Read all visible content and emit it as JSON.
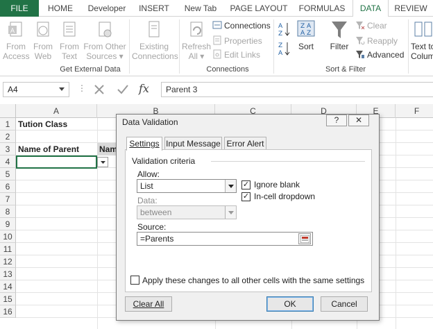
{
  "ribbon_tabs": [
    "FILE",
    "HOME",
    "Developer",
    "INSERT",
    "New Tab",
    "PAGE LAYOUT",
    "FORMULAS",
    "DATA",
    "REVIEW"
  ],
  "ribbon": {
    "get_external": {
      "from_access": [
        "From",
        "Access"
      ],
      "from_web": [
        "From",
        "Web"
      ],
      "from_text": [
        "From",
        "Text"
      ],
      "from_other": [
        "From Other",
        "Sources ▾"
      ],
      "existing": [
        "Existing",
        "Connections"
      ],
      "label": "Get External Data"
    },
    "connections": {
      "refresh": [
        "Refresh",
        "All ▾"
      ],
      "connections": "Connections",
      "properties": "Properties",
      "edit_links": "Edit Links",
      "label": "Connections"
    },
    "sort_filter": {
      "sort": "Sort",
      "filter": "Filter",
      "clear": "Clear",
      "reapply": "Reapply",
      "advanced": "Advanced",
      "label": "Sort & Filter"
    },
    "text_to_columns": [
      "Text to",
      "Colum"
    ]
  },
  "formula_bar": {
    "name_box": "A4",
    "content": "Parent 3"
  },
  "sheet": {
    "columns": [
      "A",
      "B",
      "C",
      "D",
      "E",
      "F"
    ],
    "rows": [
      "1",
      "2",
      "3",
      "4",
      "5",
      "6",
      "7",
      "8",
      "9",
      "10",
      "11",
      "12",
      "13",
      "14",
      "15",
      "16"
    ],
    "a1": "Tution Class",
    "a3": "Name of Parent",
    "b3": "Nam"
  },
  "dialog": {
    "title": "Data Validation",
    "help": "?",
    "close": "✕",
    "tabs": [
      "Settings",
      "Input Message",
      "Error Alert"
    ],
    "criteria_label": "Validation criteria",
    "allow_label": "Allow:",
    "allow_value": "List",
    "data_label": "Data:",
    "data_value": "between",
    "ignore_blank": "Ignore blank",
    "in_cell_dropdown": "In-cell dropdown",
    "source_label": "Source:",
    "source_value": "=Parents",
    "apply_all": "Apply these changes to all other cells with the same settings",
    "clear_all": "Clear All",
    "ok": "OK",
    "cancel": "Cancel"
  }
}
